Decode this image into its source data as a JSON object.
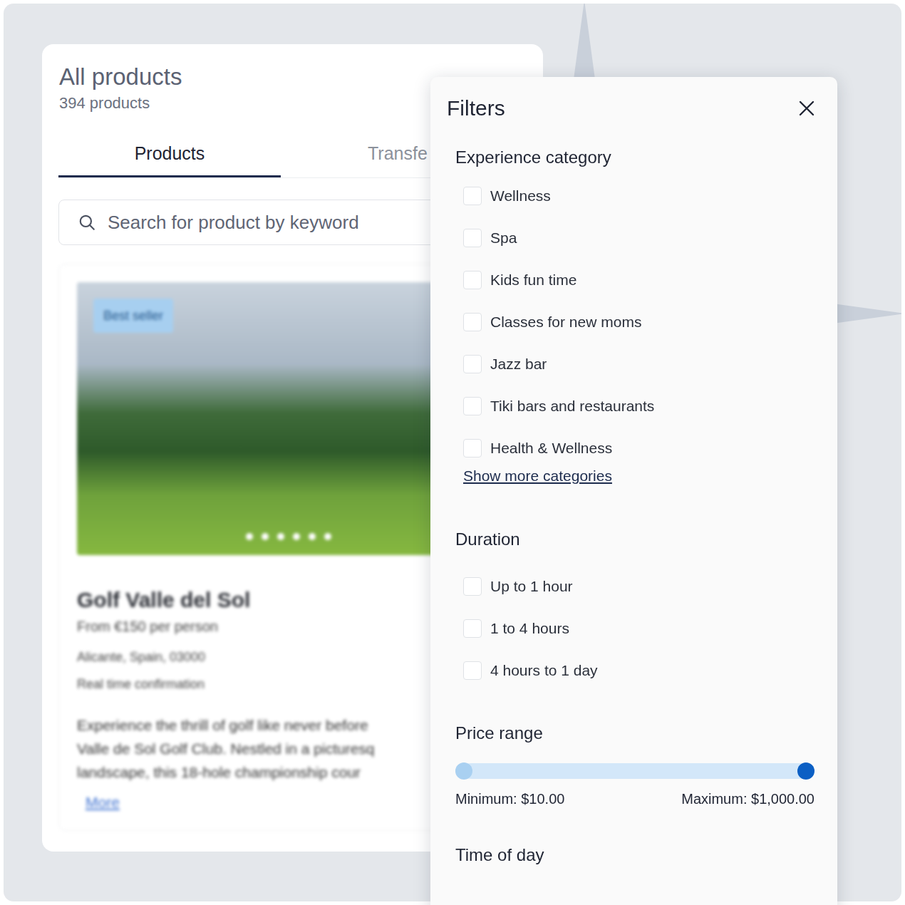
{
  "header": {
    "title": "All products",
    "count": "394 products"
  },
  "tabs": [
    {
      "label": "Products",
      "selected": true
    },
    {
      "label": "Transfe",
      "selected": false
    }
  ],
  "search": {
    "placeholder": "Search for product by keyword"
  },
  "product": {
    "badge": "Best seller",
    "title": "Golf Valle del Sol",
    "price": "From €150 per person",
    "location": "Alicante, Spain, 03000",
    "confirmation": "Real time confirmation",
    "description": [
      "Experience the thrill of golf like never before",
      "Valle de Sol Golf Club. Nestled in a picturesq",
      "landscape, this 18-hole championship cour"
    ],
    "more": "More",
    "slides": [
      {
        "selected": false
      },
      {
        "selected": false
      },
      {
        "selected": false
      },
      {
        "selected": false
      },
      {
        "selected": false
      },
      {
        "selected": false
      }
    ]
  },
  "filters": {
    "title": "Filters",
    "category": {
      "title": "Experience category",
      "items": [
        {
          "label": "Wellness",
          "checked": false
        },
        {
          "label": "Spa",
          "checked": false
        },
        {
          "label": "Kids fun time",
          "checked": false
        },
        {
          "label": "Classes for new moms",
          "checked": false
        },
        {
          "label": "Jazz bar",
          "checked": false
        },
        {
          "label": "Tiki bars and restaurants",
          "checked": false
        },
        {
          "label": "Health & Wellness",
          "checked": false
        }
      ],
      "show_more": "Show more categories"
    },
    "duration": {
      "title": "Duration",
      "items": [
        {
          "label": "Up to 1 hour",
          "checked": false
        },
        {
          "label": "1 to 4 hours",
          "checked": false
        },
        {
          "label": "4 hours to 1 day",
          "checked": false
        }
      ]
    },
    "price": {
      "title": "Price range",
      "min_level": 0,
      "max_level": 1,
      "min": "Minimum: $10.00",
      "max": "Maximum: $1,000.00"
    },
    "time_of_day": {
      "title": "Time of day"
    }
  }
}
